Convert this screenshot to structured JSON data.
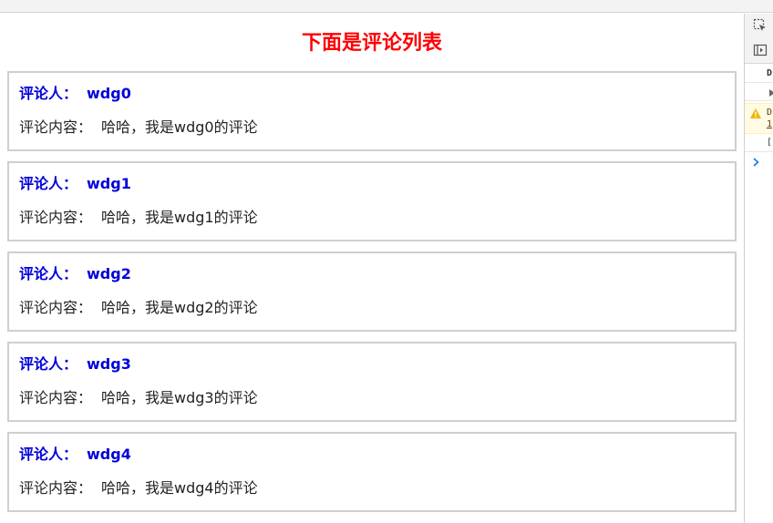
{
  "page": {
    "title": "下面是评论列表"
  },
  "comments": [
    {
      "author_label": "评论人：",
      "author": "wdg0",
      "content_label": "评论内容：",
      "content": "哈哈，我是wdg0的评论"
    },
    {
      "author_label": "评论人：",
      "author": "wdg1",
      "content_label": "评论内容：",
      "content": "哈哈，我是wdg1的评论"
    },
    {
      "author_label": "评论人：",
      "author": "wdg2",
      "content_label": "评论内容：",
      "content": "哈哈，我是wdg2的评论"
    },
    {
      "author_label": "评论人：",
      "author": "wdg3",
      "content_label": "评论内容：",
      "content": "哈哈，我是wdg3的评论"
    },
    {
      "author_label": "评论人：",
      "author": "wdg4",
      "content_label": "评论内容：",
      "content": "哈哈，我是wdg4的评论"
    }
  ],
  "devtools": {
    "row1": "D",
    "warn_text": "D",
    "warn_link": "1",
    "row3": "[",
    "icons": [
      "inspect-element-icon",
      "toggle-device-icon",
      "expand-triangle-icon",
      "warning-icon",
      "console-prompt-icon"
    ]
  },
  "colors": {
    "title": "#ff0000",
    "author": "#0000dd",
    "card_border": "#cfcfcf",
    "warning": "#f2b400",
    "prompt": "#1a73e8"
  }
}
